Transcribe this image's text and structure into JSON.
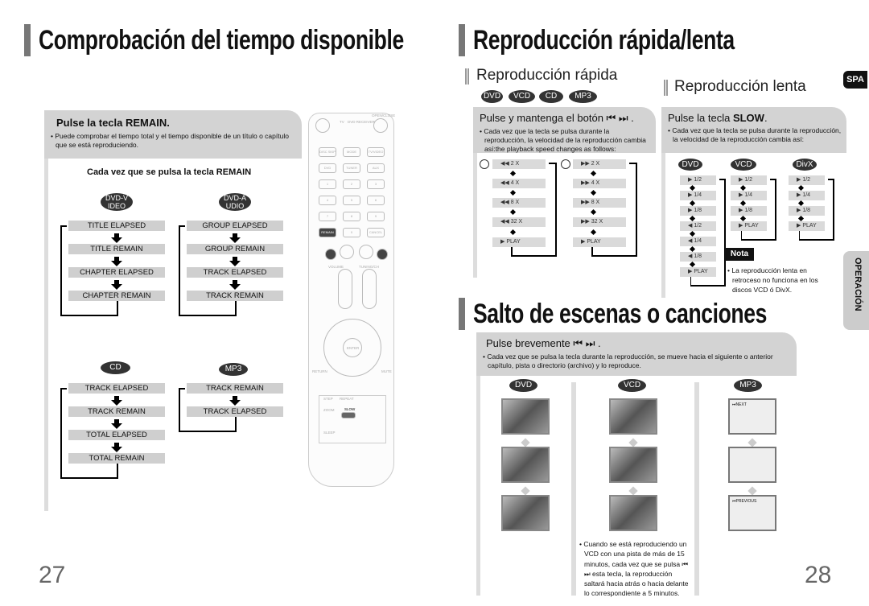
{
  "left": {
    "title": "Comprobación del tiempo disponible",
    "box": {
      "heading": "Pulse la tecla REMAIN.",
      "bullet": "Puede comprobar el tiempo total y el tiempo disponible de un título o capítulo que se está reproduciendo."
    },
    "each_press": "Cada vez que se pulsa la tecla REMAIN",
    "dvd_video": {
      "label": "DVD-VIDEO",
      "steps": [
        "TITLE ELAPSED",
        "TITLE REMAIN",
        "CHAPTER ELAPSED",
        "CHAPTER REMAIN"
      ]
    },
    "dvd_audio": {
      "label": "DVD-AUDIO",
      "steps": [
        "GROUP ELAPSED",
        "GROUP REMAIN",
        "TRACK ELAPSED",
        "TRACK REMAIN"
      ]
    },
    "cd": {
      "label": "CD",
      "steps": [
        "TRACK ELAPSED",
        "TRACK REMAIN",
        "TOTAL ELAPSED",
        "TOTAL REMAIN"
      ]
    },
    "mp3": {
      "label": "MP3",
      "steps": [
        "TRACK REMAIN",
        "TRACK ELAPSED"
      ]
    },
    "page_number": "27"
  },
  "remote": {
    "labels": [
      "OPEN/CLOSE",
      "TV",
      "DVD RECEIVER",
      "DISC SKIP",
      "MODE",
      "TV/VIDEO",
      "DVD",
      "TUNER",
      "AUX",
      "1",
      "2",
      "3",
      "4",
      "5",
      "6",
      "7",
      "8",
      "9",
      "REMAIN",
      "0",
      "CANCEL",
      "VOLUME",
      "TUNING/CH",
      "ENTER",
      "RETURN",
      "MUTE",
      "STEP",
      "REPEAT",
      "ZOOM",
      "SLOW",
      "SLEEP"
    ]
  },
  "right": {
    "title": "Reproducción rápida/lenta",
    "fast": {
      "subtitle": "Reproducción rápida",
      "discs": [
        "DVD",
        "VCD",
        "CD",
        "MP3"
      ],
      "heading": "Pulse y mantenga el botón ⏮ ⏭ .",
      "bullet": "Cada vez que la tecla se pulsa  durante la reproducción, la velocidad de la reproducción cambia así:the playback speed changes as follows:",
      "rewind": [
        "◀◀  2 X",
        "◀◀  4 X",
        "◀◀  8 X",
        "◀◀  32 X",
        "▶  PLAY"
      ],
      "forward": [
        "▶▶  2 X",
        "▶▶  4 X",
        "▶▶  8 X",
        "▶▶  32 X",
        "▶  PLAY"
      ]
    },
    "slow": {
      "subtitle": "Reproducción lenta",
      "heading_pre": "Pulse la tecla ",
      "heading_key": "SLOW",
      "heading_post": ".",
      "bullet": "Cada vez que la tecla se pulsa  durante la reproducción, la velocidad de la reproducción cambia así:",
      "dvd": {
        "label": "DVD",
        "steps": [
          "▶ 1/2",
          "▶ 1/4",
          "▶ 1/8",
          "◀ 1/2",
          "◀ 1/4",
          "◀ 1/8",
          "▶ PLAY"
        ]
      },
      "vcd": {
        "label": "VCD",
        "steps": [
          "▶ 1/2",
          "▶ 1/4",
          "▶ 1/8",
          "▶ PLAY"
        ]
      },
      "divx": {
        "label": "DivX",
        "steps": [
          "▶ 1/2",
          "▶ 1/4",
          "▶ 1/8",
          "▶ PLAY"
        ]
      },
      "note_label": "Nota",
      "note": "La reproducción lenta en retroceso no funciona en los discos VCD ó DivX."
    },
    "skip": {
      "title": "Salto de escenas o canciones",
      "heading": "Pulse brevemente ⏮ ⏭ .",
      "bullet": "Cada vez que se pulsa la tecla durante la reproducción, se mueve hacia el siguiente o anterior capítulo, pista o directorio (archivo) y lo reproduce.",
      "columns": [
        "DVD",
        "VCD",
        "MP3"
      ],
      "mp3_screens": [
        "⏭NEXT",
        "",
        "⏮PREVIOUS"
      ],
      "vcd_note": "Cuando se está reproduciendo un VCD con una pista de más de 15 minutos, cada vez que se pulsa ⏮ ⏭ esta tecla, la reproducción saltará hacia atrás o hacia delante lo correspondiente a 5 minutos."
    },
    "lang_badge": "SPA",
    "section_tab": "OPERACIÓN",
    "page_number": "28"
  }
}
